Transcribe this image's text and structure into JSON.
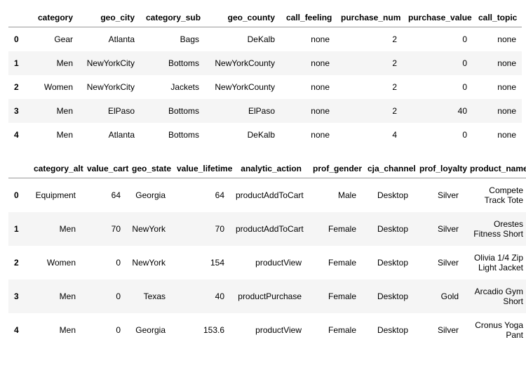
{
  "table1": {
    "columns": [
      "category",
      "geo_city",
      "category_sub",
      "geo_county",
      "call_feeling",
      "purchase_num",
      "purchase_value",
      "call_topic"
    ],
    "rows": [
      {
        "idx": "0",
        "cells": [
          "Gear",
          "Atlanta",
          "Bags",
          "DeKalb",
          "none",
          "2",
          "0",
          "none"
        ]
      },
      {
        "idx": "1",
        "cells": [
          "Men",
          "NewYorkCity",
          "Bottoms",
          "NewYorkCounty",
          "none",
          "2",
          "0",
          "none"
        ]
      },
      {
        "idx": "2",
        "cells": [
          "Women",
          "NewYorkCity",
          "Jackets",
          "NewYorkCounty",
          "none",
          "2",
          "0",
          "none"
        ]
      },
      {
        "idx": "3",
        "cells": [
          "Men",
          "ElPaso",
          "Bottoms",
          "ElPaso",
          "none",
          "2",
          "40",
          "none"
        ]
      },
      {
        "idx": "4",
        "cells": [
          "Men",
          "Atlanta",
          "Bottoms",
          "DeKalb",
          "none",
          "4",
          "0",
          "none"
        ]
      }
    ]
  },
  "table2": {
    "columns": [
      "category_alt",
      "value_cart",
      "geo_state",
      "value_lifetime",
      "analytic_action",
      "prof_gender",
      "cja_channel",
      "prof_loyalty",
      "product_name"
    ],
    "rows": [
      {
        "idx": "0",
        "cells": [
          "Equipment",
          "64",
          "Georgia",
          "64",
          "productAddToCart",
          "Male",
          "Desktop",
          "Silver",
          "Compete Track Tote"
        ]
      },
      {
        "idx": "1",
        "cells": [
          "Men",
          "70",
          "NewYork",
          "70",
          "productAddToCart",
          "Female",
          "Desktop",
          "Silver",
          "Orestes Fitness Short"
        ]
      },
      {
        "idx": "2",
        "cells": [
          "Women",
          "0",
          "NewYork",
          "154",
          "productView",
          "Female",
          "Desktop",
          "Silver",
          "Olivia 1/4 Zip Light Jacket"
        ]
      },
      {
        "idx": "3",
        "cells": [
          "Men",
          "0",
          "Texas",
          "40",
          "productPurchase",
          "Female",
          "Desktop",
          "Gold",
          "Arcadio Gym Short"
        ]
      },
      {
        "idx": "4",
        "cells": [
          "Men",
          "0",
          "Georgia",
          "153.6",
          "productView",
          "Female",
          "Desktop",
          "Silver",
          "Cronus Yoga Pant"
        ]
      }
    ]
  }
}
